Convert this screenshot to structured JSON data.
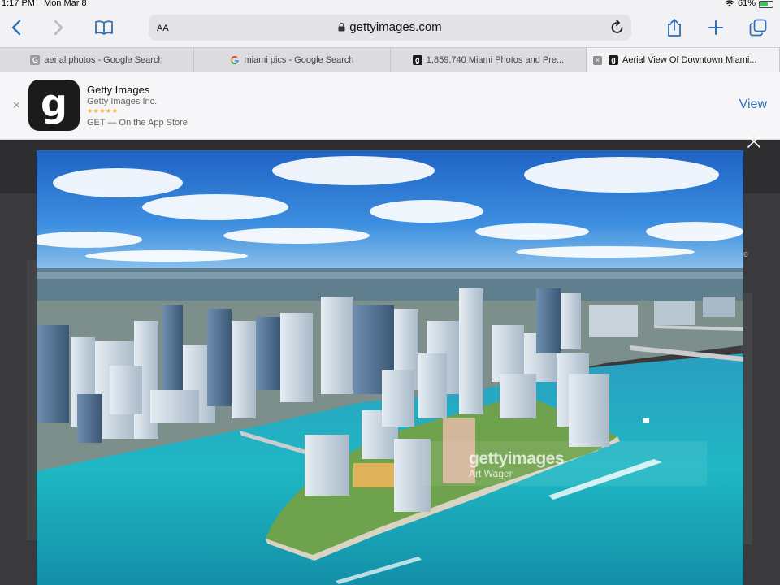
{
  "status_bar": {
    "time": "1:17 PM",
    "date": "Mon Mar 8",
    "battery_percent": "61%",
    "battery_level": 0.61
  },
  "toolbar": {
    "text_size_label": "AA",
    "url": "gettyimages.com",
    "icons": [
      "back-icon",
      "forward-icon",
      "bookmarks-icon",
      "lock-icon",
      "reload-icon",
      "share-icon",
      "new-tab-icon",
      "tabs-overview-icon"
    ]
  },
  "tabs": [
    {
      "label": "aerial photos - Google Search",
      "favicon": "G"
    },
    {
      "label": "miami pics - Google Search",
      "favicon": "google"
    },
    {
      "label": "1,859,740 Miami Photos and Pre...",
      "favicon": "getty"
    },
    {
      "label": "Aerial View Of Downtown Miami...",
      "favicon": "getty",
      "active": true
    }
  ],
  "app_banner": {
    "app_name": "Getty Images",
    "company": "Getty Images Inc.",
    "rating_stars": "★★★★★",
    "get_text": "GET — On the App Store",
    "view_label": "View",
    "icon_letter": "g"
  },
  "photo": {
    "watermark_brand": "gettyimages",
    "watermark_credit": "Art Wager"
  },
  "page_fragment": "e",
  "colors": {
    "accent": "#2a6fb8",
    "toolbar_bg": "#f2f2f4",
    "water": "#1fb8c4",
    "sky": "#2f7fd6"
  }
}
